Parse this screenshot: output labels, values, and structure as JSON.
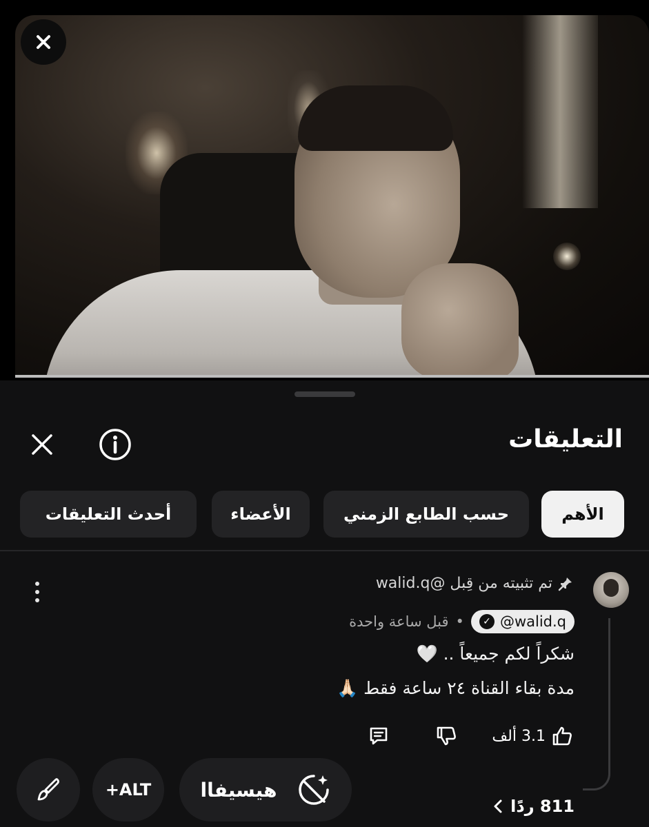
{
  "sheet": {
    "title": "التعليقات",
    "tabs": [
      {
        "label": "الأهم",
        "active": true
      },
      {
        "label": "حسب الطابع الزمني",
        "active": false
      },
      {
        "label": "الأعضاء",
        "active": false
      },
      {
        "label": "أحدث التعليقات",
        "active": false
      }
    ]
  },
  "comment": {
    "pinned_text": "تم تثبيته من قِبل @walid.q",
    "handle": "@walid.q",
    "time": "قبل ساعة واحدة",
    "separator": "•",
    "line1": "شكراً لكم جميعاً .. 🤍",
    "line2": "مدة بقاء القناة ٢٤ ساعة فقط 🙏🏻",
    "likes": "3.1 ألف",
    "replies": "811 ردًا"
  },
  "toolbar": {
    "alt_label": "+ALT",
    "ai_label": "هيسيفاا"
  },
  "icons": {
    "close_video": "close-icon",
    "info": "info-icon",
    "close_sheet": "close-icon",
    "pin": "pin-icon",
    "verified": "verified-check-icon",
    "like": "thumbs-up-icon",
    "dislike": "thumbs-down-icon",
    "reply": "comment-icon",
    "more": "more-vertical-icon",
    "brush": "brush-icon",
    "replies_chevron": "chevron-left-icon"
  }
}
